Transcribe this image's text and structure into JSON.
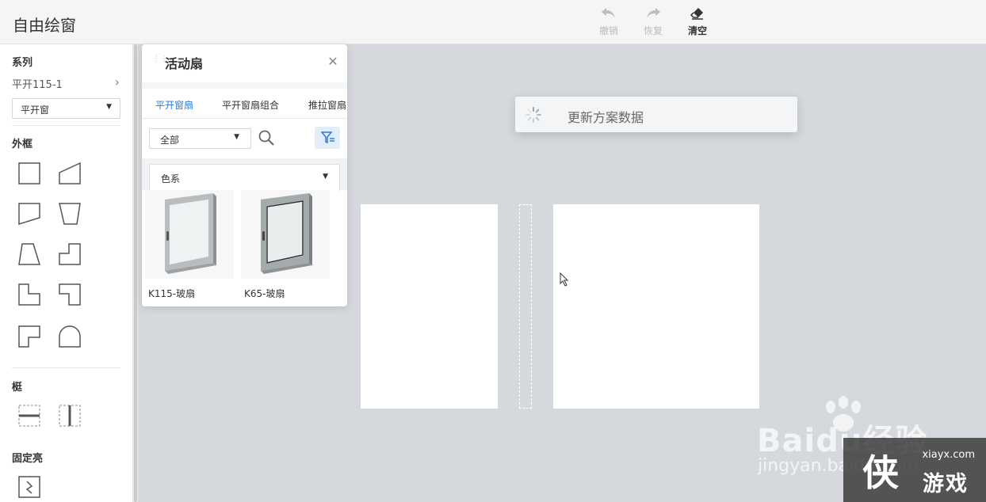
{
  "app": {
    "title": "自由绘窗"
  },
  "toolbar": {
    "undo_label": "撤销",
    "redo_label": "恢复",
    "clear_label": "清空"
  },
  "sidebar": {
    "series_title": "系列",
    "series_value": "平开115-1",
    "window_type": "平开窗",
    "outer_frame_title": "外框",
    "outer_frame_icons": [
      "square-shape-icon",
      "slanted-top-shape-icon",
      "slanted-bottom-shape-icon",
      "trapezoid-shape-icon",
      "trapezoid-left-shape-icon",
      "notched-top-right-shape-icon",
      "notched-top-left-shape-icon",
      "notched-right-shape-icon",
      "notched-bottom-right-shape-icon",
      "arch-shape-icon"
    ],
    "mullion_title": "梃",
    "mullion_icons": [
      "horizontal-mullion-icon",
      "vertical-mullion-icon"
    ],
    "fixed_light_title": "固定亮",
    "fixed_light_icons": [
      "fixed-glass-icon"
    ]
  },
  "panel": {
    "title": "活动扇",
    "tabs": [
      "平开窗扇",
      "平开窗扇组合",
      "推拉窗扇"
    ],
    "active_tab": 0,
    "filter_value": "全部",
    "color_select": "色系",
    "products": [
      {
        "name": "K115-玻扇"
      },
      {
        "name": "K65-玻扇"
      }
    ]
  },
  "canvas": {
    "loading_text": "更新方案数据"
  },
  "watermark": {
    "baidu": "Baidu经验",
    "jingyan": "jingyan.baidu.com",
    "site": "xiayx.com",
    "big_char": "侠",
    "sub": "游戏"
  },
  "colors": {
    "accent": "#2d7bd6",
    "canvas_bg": "#d5d8dd",
    "disabled": "#b9bcc1"
  }
}
